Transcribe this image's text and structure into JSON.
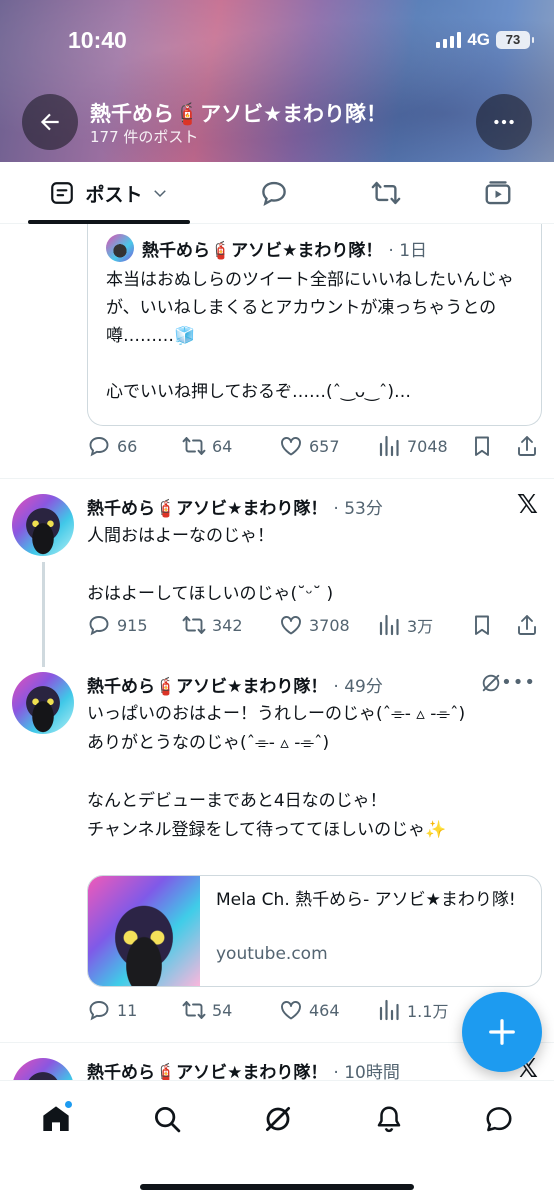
{
  "status_bar": {
    "time": "10:40",
    "network": "4G",
    "battery": "73"
  },
  "header": {
    "title": "熱千めら🧯アソビ★まわり隊！",
    "subtitle": "177 件のポスト"
  },
  "tabs": {
    "posts_label": "ポスト"
  },
  "quote": {
    "name": "熱千めら🧯アソビ★まわり隊！",
    "time": "· 1日",
    "text": "本当はおぬしらのツイート全部にいいねしたいんじゃが、いいねしまくるとアカウントが凍っちゃうとの噂………🧊\n\n心でいいね押しておるぞ……(ˆ‿ᴗ‿ˆ)…",
    "stats": {
      "replies": "66",
      "reposts": "64",
      "likes": "657",
      "views": "7048"
    }
  },
  "posts": [
    {
      "name": "熱千めら🧯アソビ★まわり隊！",
      "time": "· 53分",
      "text": "人間おはよーなのじゃ！\n\nおはよーしてほしいのじゃ(˘ᵕ˘ )",
      "stats": {
        "replies": "915",
        "reposts": "342",
        "likes": "3708",
        "views": "3万"
      }
    },
    {
      "name": "熱千めら🧯アソビ★まわり隊！",
      "time": "· 49分",
      "text": "いっぱいのおはよー！うれしーのじゃ(ˆ⌯- ▵ -⌯ˆ)\nありがとうなのじゃ(ˆ⌯- ▵ -⌯ˆ)\n\nなんとデビューまであと4日なのじゃ！\nチャンネル登録をして待っててほしいのじゃ✨",
      "link": {
        "title": "Mela Ch. 熱千めら- アソビ★まわり隊!",
        "domain": "youtube.com"
      },
      "stats": {
        "replies": "11",
        "reposts": "54",
        "likes": "464",
        "views": "1.1万"
      }
    },
    {
      "name": "熱千めら🧯アソビ★まわり隊！",
      "time": "· 10時間"
    }
  ],
  "icons": {
    "back": "arrow-left-icon",
    "more": "more-horizontal-icon",
    "reply": "reply-icon",
    "repost": "repost-icon",
    "like": "heart-icon",
    "views": "views-icon",
    "bookmark": "bookmark-icon",
    "share": "share-icon",
    "compose": "plus-icon",
    "home": "home-icon",
    "search": "search-icon",
    "grok": "grok-icon",
    "notifications": "bell-icon",
    "messages": "message-icon"
  },
  "colors": {
    "accent": "#1d9bf0",
    "text": "#0f1419",
    "secondary": "#536471"
  }
}
